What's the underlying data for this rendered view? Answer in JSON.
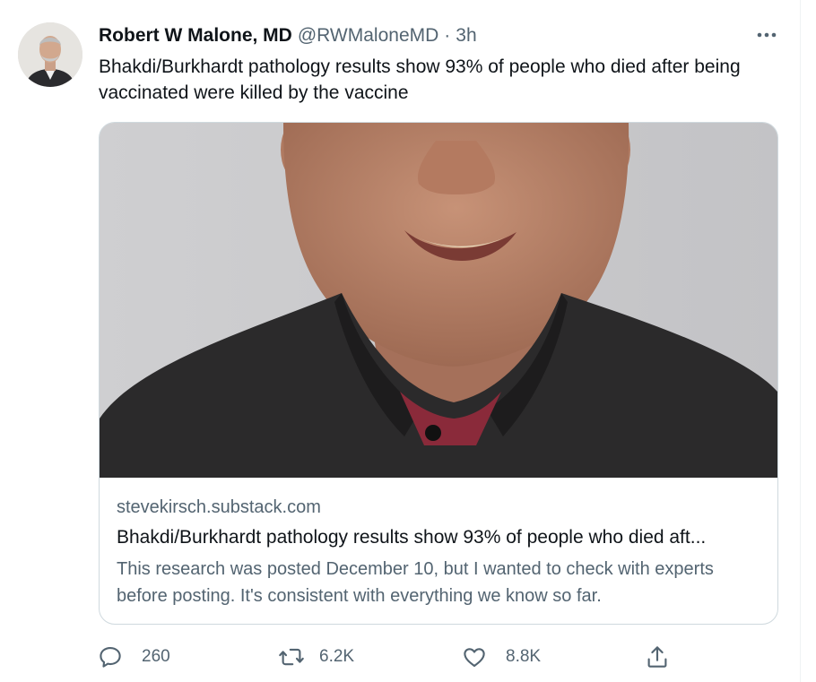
{
  "author": {
    "name": "Robert W Malone, MD",
    "handle": "@RWMaloneMD",
    "separator": "·",
    "time": "3h",
    "avatar_icon": "author-avatar"
  },
  "tweet": {
    "text": "Bhakdi/Burkhardt pathology results show 93% of people who died after being vaccinated were killed by the vaccine",
    "more_icon": "more-options-icon"
  },
  "card": {
    "domain": "stevekirsch.substack.com",
    "title": "Bhakdi/Burkhardt pathology results show 93% of people who died aft...",
    "description": "This research was posted December 10, but I wanted to check with experts before posting. It's consistent with everything we know so far.",
    "image_icon": "man-portrait-photo"
  },
  "actions": {
    "reply": {
      "icon": "reply-icon",
      "count": "260"
    },
    "retweet": {
      "icon": "retweet-icon",
      "count": "6.2K"
    },
    "like": {
      "icon": "like-icon",
      "count": "8.8K"
    },
    "share": {
      "icon": "share-icon"
    }
  },
  "colors": {
    "text_primary": "#0f1419",
    "text_secondary": "#536471",
    "border": "#cfd9de"
  }
}
